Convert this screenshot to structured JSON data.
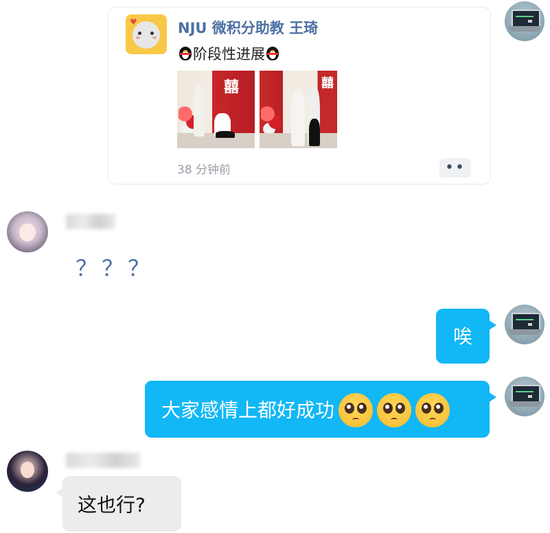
{
  "card": {
    "title": "NJU 微积分助教 王琦",
    "subtitle": "阶段性进展",
    "time": "38 分钟前",
    "more_label": "••",
    "icons": [
      "cat-sticker-icon",
      "penguin-icon",
      "more-dots-icon"
    ]
  },
  "messages": [
    {
      "side": "left",
      "text": "？？？"
    },
    {
      "side": "right",
      "text": "唉"
    },
    {
      "side": "right",
      "text": "大家感情上都好成功",
      "emoji": "pleading-face"
    },
    {
      "side": "left",
      "text": "这也行?"
    }
  ],
  "colors": {
    "bubble_blue": "#12b7f5",
    "bubble_gray": "#ececec",
    "name_link": "#4d6fa2"
  }
}
